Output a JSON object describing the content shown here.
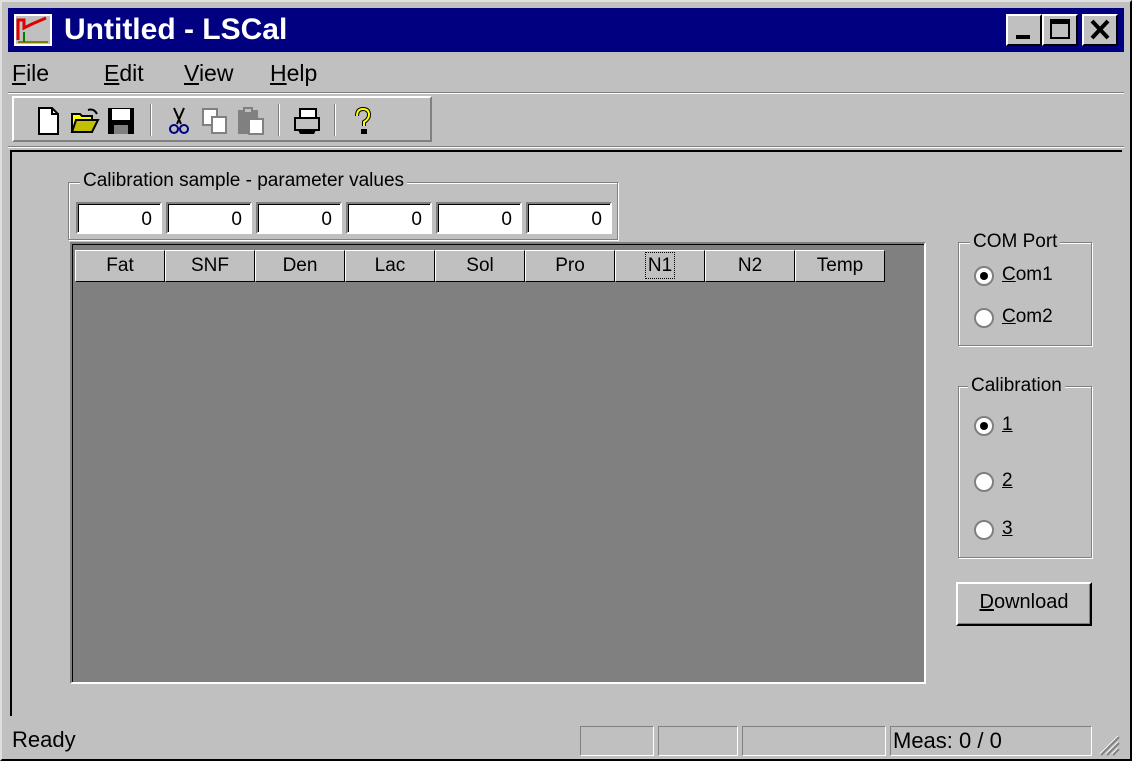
{
  "window": {
    "title": "Untitled - LSCal"
  },
  "menu": [
    {
      "label": "File",
      "accel": "F",
      "rest": "ile"
    },
    {
      "label": "Edit",
      "accel": "E",
      "rest": "dit"
    },
    {
      "label": "View",
      "accel": "V",
      "rest": "iew"
    },
    {
      "label": "Help",
      "accel": "H",
      "rest": "elp"
    }
  ],
  "toolbar": {
    "icons": [
      "new-file-icon",
      "open-folder-icon",
      "save-disk-icon",
      "cut-scissors-icon",
      "copy-icon",
      "paste-icon",
      "print-icon",
      "help-icon"
    ]
  },
  "calibration_sample": {
    "label": "Calibration sample - parameter values",
    "values": [
      "0",
      "0",
      "0",
      "0",
      "0",
      "0"
    ]
  },
  "grid": {
    "columns": [
      "Fat",
      "SNF",
      "Den",
      "Lac",
      "Sol",
      "Pro",
      "N1",
      "N2",
      "Temp"
    ],
    "focused_column": "N1"
  },
  "com_port": {
    "label": "COM Port",
    "options": [
      {
        "accel": "C",
        "rest": "om1",
        "checked": true
      },
      {
        "accel": "C",
        "rest": "om2",
        "checked": false
      }
    ]
  },
  "calibration": {
    "label": "Calibration",
    "options": [
      {
        "accel": "1",
        "checked": true
      },
      {
        "accel": "2",
        "checked": false
      },
      {
        "accel": "3",
        "checked": false
      }
    ]
  },
  "download_button": {
    "accel": "D",
    "rest": "ownload"
  },
  "status": {
    "text": "Ready",
    "meas": "Meas: 0 / 0"
  },
  "colors": {
    "title_bar": "#000080",
    "face": "#c0c0c0",
    "grid_background": "#808080"
  }
}
